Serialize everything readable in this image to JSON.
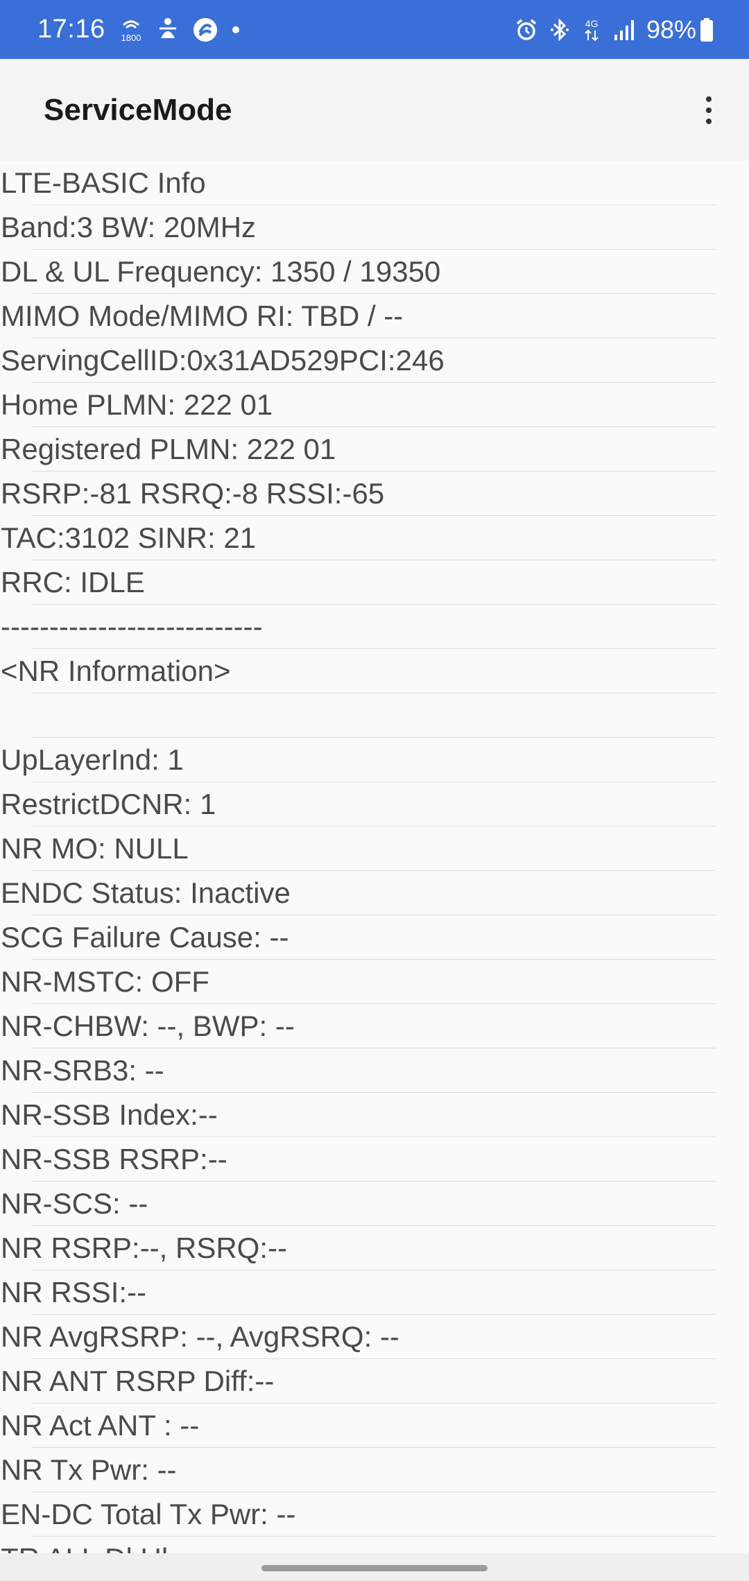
{
  "status_bar": {
    "time": "17:16",
    "battery": "98%",
    "left_icons": [
      "wifi-calling-icon",
      "accessibility-icon",
      "data-saver-icon",
      "notification-dot-icon"
    ],
    "right_icons": [
      "alarm-icon",
      "bluetooth-icon",
      "4g-data-icon",
      "signal-icon",
      "battery-icon"
    ],
    "network_label": "4G",
    "bg_color": "#3a6fd8"
  },
  "app_bar": {
    "title": "ServiceMode",
    "menu_icon": "more-vert-icon"
  },
  "info_lines": [
    "LTE-BASIC Info",
    "Band:3 BW: 20MHz",
    "DL & UL Frequency: 1350 / 19350",
    "MIMO Mode/MIMO RI: TBD / --",
    "ServingCellID:0x31AD529PCI:246",
    "Home PLMN: 222 01",
    "Registered PLMN: 222 01",
    "RSRP:-81 RSRQ:-8 RSSI:-65",
    "TAC:3102 SINR: 21",
    "RRC: IDLE",
    "---------------------------",
    "<NR Information>",
    "",
    "UpLayerInd: 1",
    "RestrictDCNR: 1",
    "NR MO: NULL",
    "ENDC Status: Inactive",
    "SCG Failure Cause: --",
    "NR-MSTC: OFF",
    "NR-CHBW: --, BWP: --",
    "NR-SRB3: --",
    "NR-SSB Index:--",
    "NR-SSB RSRP:--",
    "NR-SCS: --",
    "NR RSRP:--, RSRQ:--",
    "NR RSSI:--",
    "NR AvgRSRP: --, AvgRSRQ: --",
    "NR ANT RSRP Diff:--",
    "NR Act ANT : --",
    "NR Tx Pwr: --",
    "EN-DC Total Tx Pwr: --",
    "TR ALL Dl Ul"
  ]
}
